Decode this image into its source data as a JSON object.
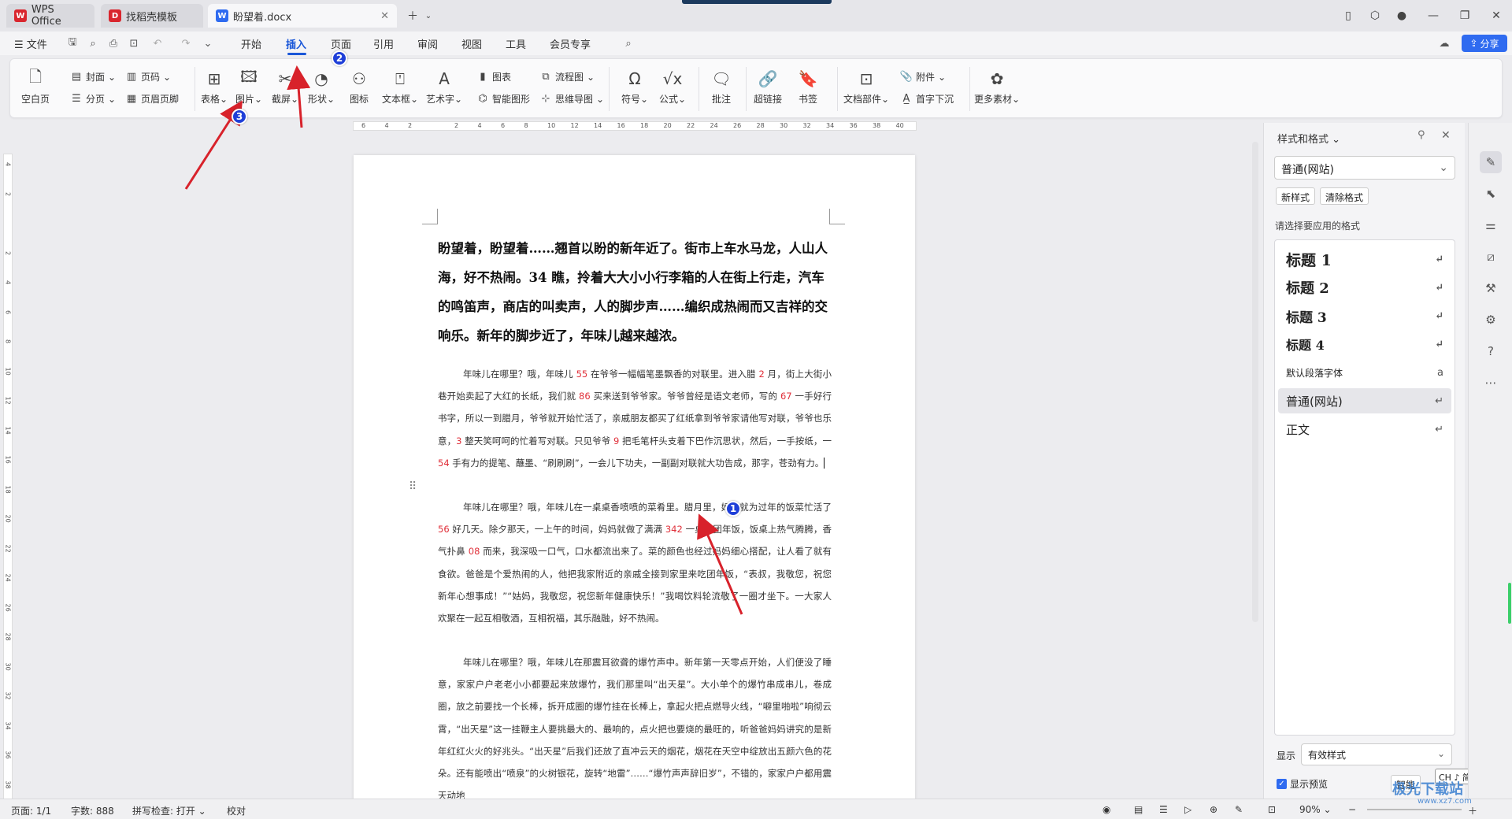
{
  "tabs": [
    {
      "label": "WPS Office",
      "logo": "W",
      "logo_color": "#d9262e"
    },
    {
      "label": "找稻壳模板",
      "logo": "D",
      "logo_color": "#d9262e"
    },
    {
      "label": "盼望着.docx",
      "logo": "W",
      "logo_color": "#2f6bf0"
    }
  ],
  "menu": {
    "file": "文件",
    "items": [
      "开始",
      "插入",
      "页面",
      "引用",
      "审阅",
      "视图",
      "工具",
      "会员专享"
    ],
    "active": "插入",
    "share": "分享"
  },
  "ribbon": {
    "blank_page": "空白页",
    "cover": "封面",
    "section_break": "分页",
    "page_num": "页码",
    "header_footer": "页眉页脚",
    "table": "表格",
    "picture": "图片",
    "screenshot": "截屏",
    "shape": "形状",
    "icon": "图标",
    "textbox": "文本框",
    "wordart": "艺术字",
    "chart": "图表",
    "smartart": "智能图形",
    "flowchart": "流程图",
    "mindmap": "思维导图",
    "symbol": "符号",
    "formula": "公式",
    "comment": "批注",
    "hyperlink": "超链接",
    "bookmark": "书签",
    "doc_parts": "文档部件",
    "attachment": "附件",
    "dropcap": "首字下沉",
    "more": "更多素材"
  },
  "ruler_ticks": [
    "6",
    "4",
    "2",
    "",
    "2",
    "4",
    "6",
    "8",
    "10",
    "12",
    "14",
    "16",
    "18",
    "20",
    "22",
    "24",
    "26",
    "28",
    "30",
    "32",
    "34",
    "36",
    "38",
    "40"
  ],
  "vruler_ticks": [
    "4",
    "2",
    "",
    "2",
    "4",
    "6",
    "8",
    "10",
    "12",
    "14",
    "16",
    "18",
    "20",
    "22",
    "24",
    "26",
    "28",
    "30",
    "32",
    "34",
    "36",
    "38"
  ],
  "document": {
    "title_para": "盼望着，盼望着……翘首以盼的新年近了。街市上车水马龙，人山人海，好不热闹。34 瞧，拎着大大小小行李箱的人在街上行走，汽车的鸣笛声，商店的叫卖声，人的脚步声……编织成热闹而又吉祥的交响乐。新年的脚步近了，年味儿越来越浓。",
    "p1": [
      {
        "t": "年味儿在哪里？哦，年味儿 "
      },
      {
        "t": "55",
        "r": true
      },
      {
        "t": " 在爷爷一幅幅笔墨飘香的对联里。进入腊 "
      },
      {
        "t": "2",
        "r": true
      },
      {
        "t": " 月，街上大街小巷开始卖起了大红的长纸，我们就 "
      },
      {
        "t": "86",
        "r": true
      },
      {
        "t": " 买来送到爷爷家。爷爷曾经是语文老师，写的 "
      },
      {
        "t": "67",
        "r": true
      },
      {
        "t": " 一手好行书字，所以一到腊月，爷爷就开始忙活了，亲戚朋友都买了红纸拿到爷爷家请他写对联，爷爷也乐意，"
      },
      {
        "t": "3",
        "r": true
      },
      {
        "t": " 整天笑呵呵的忙着写对联。只见爷爷 "
      },
      {
        "t": "9",
        "r": true
      },
      {
        "t": " 把毛笔杆头支着下巴作沉思状，然后，一手按纸，一 "
      },
      {
        "t": "54",
        "r": true
      },
      {
        "t": " 手有力的提笔、蘸墨、“刷刷刷”，一会儿下功夫，一副副对联就大功告成，那字，苍劲有力。"
      }
    ],
    "p2": [
      {
        "t": "年味儿在哪里？哦，年味儿在一桌桌香喷喷的菜肴里。腊月里，妈妈就为过年的饭菜忙活了 "
      },
      {
        "t": "56",
        "r": true
      },
      {
        "t": " 好几天。除夕那天，一上午的时间，妈妈就做了满满 "
      },
      {
        "t": "342",
        "r": true
      },
      {
        "t": " 一桌子团年饭，饭桌上热气腾腾，香气扑鼻 "
      },
      {
        "t": "08",
        "r": true
      },
      {
        "t": " 而来，我深吸一口气，口水都流出来了。菜的颜色也经过妈妈细心搭配，让人看了就有食欲。爸爸是个爱热闹的人，他把我家附近的亲戚全接到家里来吃团年饭，“表叔，我敬您，祝您新年心想事成！”“姑妈，我敬您，祝您新年健康快乐！”我喝饮料轮流敬了一圈才坐下。一大家人欢聚在一起互相敬酒，互相祝福，其乐融融，好不热闹。"
      }
    ],
    "p3": "年味儿在哪里？哦，年味儿在那震耳欲聋的爆竹声中。新年第一天零点开始，人们便没了睡意，家家户户老老小小都要起来放爆竹，我们那里叫“出天星”。大小单个的爆竹串成串儿，卷成圈，放之前要找一个长棒，拆开成圈的爆竹挂在长棒上，拿起火把点燃导火线，“噼里啪啦”响彻云霄，“出天星”这一挂鞭主人要挑最大的、最响的，点火把也要烧的最旺的，听爸爸妈妈讲究的是新年红红火火的好兆头。“出天星”后我们还放了直冲云天的烟花，烟花在天空中绽放出五颜六色的花朵。还有能喷出“喷泉”的火树银花，旋转“地雷”……“爆竹声声辞旧岁”，不错的，家家户户都用震天动地"
  },
  "pane": {
    "title": "样式和格式",
    "current_style": "普通(网站)",
    "new_style": "新样式",
    "clear_format": "清除格式",
    "hint": "请选择要应用的格式",
    "styles": [
      {
        "label": "标题  1",
        "mark": "↵"
      },
      {
        "label": "标题  2",
        "mark": "↵"
      },
      {
        "label": "标题  3",
        "mark": "↵"
      },
      {
        "label": "标题 4",
        "mark": "↵"
      },
      {
        "label": "默认段落字体",
        "mark": "a"
      },
      {
        "label": "普通(网站)",
        "mark": "↵"
      },
      {
        "label": "正文",
        "mark": "↵"
      }
    ],
    "show_label": "显示",
    "show_value": "有效样式",
    "preview": "显示预览",
    "smart": "智能",
    "ime": "CH ♪ 简"
  },
  "status": {
    "page": "页面: 1/1",
    "words": "字数: 888",
    "spell": "拼写检查: 打开",
    "proof": "校对",
    "zoom": "90%"
  },
  "badges": [
    "1",
    "2",
    "3"
  ],
  "watermark": "极光下载站",
  "watermark_url": "www.xz7.com",
  "colors": {
    "accent": "#1a57d8",
    "share": "#2f6bf0",
    "arrow": "#d8222b",
    "badge": "#1f3fd8",
    "red_digits": "#e0303a"
  }
}
